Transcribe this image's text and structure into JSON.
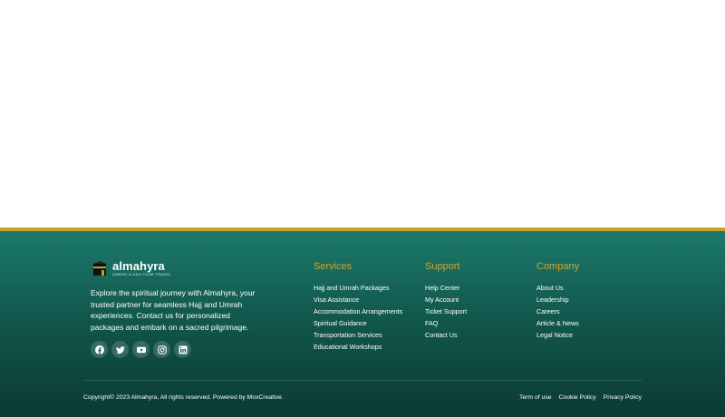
{
  "colors": {
    "accent_gold": "#c8a02a",
    "heading_gold": "#d4a52c",
    "footer_top": "#1b7a6b",
    "footer_bottom": "#0a3a34"
  },
  "brand": {
    "name": "almahyra",
    "tagline": "UMROH & HAJI TOUR TRAVEL",
    "logo_icon": "kaaba-icon",
    "description": "Explore the spiritual journey with Almahyra, your trusted partner for seamless Hajj and Umrah experiences. Contact us for personalized packages and embark on a sacred pilgrimage."
  },
  "socials": [
    {
      "icon": "facebook-icon"
    },
    {
      "icon": "twitter-icon"
    },
    {
      "icon": "youtube-icon"
    },
    {
      "icon": "instagram-icon"
    },
    {
      "icon": "linkedin-icon"
    }
  ],
  "services": {
    "title": "Services",
    "items": [
      "Hajj and Umrah Packages",
      "Visa Assistance",
      "Accommodation Arrangements",
      "Spiritual Guidance",
      "Transportation Services",
      "Educational Workshops"
    ]
  },
  "support": {
    "title": "Support",
    "items": [
      "Help Center",
      "My Account",
      "Ticket Support",
      "FAQ",
      "Contact Us"
    ]
  },
  "company": {
    "title": "Company",
    "items": [
      "About Us",
      "Leadership",
      "Careers",
      "Article & News",
      "Legal Notice"
    ]
  },
  "bottom": {
    "copyright": "Copyright© 2023 Almahyra, All rights reserved. Powered by MoxCreative.",
    "links": [
      "Term of use",
      "Cookie Policy",
      "Privacy Policy"
    ]
  }
}
